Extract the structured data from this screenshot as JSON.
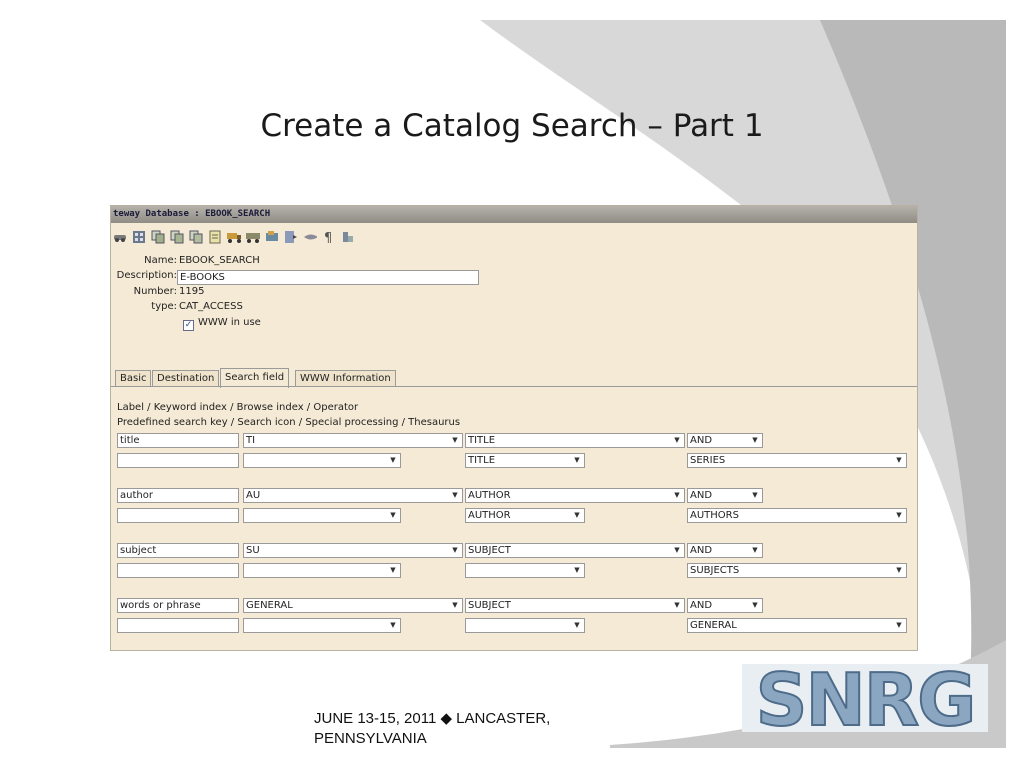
{
  "slide": {
    "title": "Create a Catalog Search – Part 1",
    "footer_line1": "JUNE 13-15, 2011 ◆ LANCASTER,",
    "footer_line2": "PENNSYLVANIA",
    "logo_text": "SNRG"
  },
  "window": {
    "title": "teway Database : EBOOK_SEARCH"
  },
  "toolbar": {
    "icons": [
      "car-icon",
      "grid-icon",
      "copy-icon",
      "copy-alt-icon",
      "copy-third-icon",
      "document-icon",
      "truck-icon",
      "vehicle-icon",
      "cart-icon",
      "export-icon",
      "handshake-icon",
      "paragraph-icon",
      "stack-icon"
    ]
  },
  "record": {
    "name_label": "Name:",
    "name_value": "EBOOK_SEARCH",
    "description_label": "Description:",
    "description_value": "E-BOOKS",
    "number_label": "Number:",
    "number_value": "1195",
    "type_label": "type:",
    "type_value": "CAT_ACCESS",
    "www_label": "WWW in use",
    "www_checked": true
  },
  "tabs": [
    {
      "label": "Basic"
    },
    {
      "label": "Destination"
    },
    {
      "label": "Search field"
    },
    {
      "label": "WWW Information"
    }
  ],
  "search_fields": {
    "header_line1": "Label / Keyword index / Browse index / Operator",
    "header_line2": "Predefined search key / Search icon / Special processing / Thesaurus",
    "rows": [
      {
        "label": "title",
        "keyword": "TI",
        "browse": "TITLE",
        "operator": "AND",
        "predef": "",
        "icon": "",
        "special": "TITLE",
        "thesaurus": "SERIES"
      },
      {
        "label": "author",
        "keyword": "AU",
        "browse": "AUTHOR",
        "operator": "AND",
        "predef": "",
        "icon": "",
        "special": "AUTHOR",
        "thesaurus": "AUTHORS"
      },
      {
        "label": "subject",
        "keyword": "SU",
        "browse": "SUBJECT",
        "operator": "AND",
        "predef": "",
        "icon": "",
        "special": "",
        "thesaurus": "SUBJECTS"
      },
      {
        "label": "words or phrase",
        "keyword": "GENERAL",
        "browse": "SUBJECT",
        "operator": "AND",
        "predef": "",
        "icon": "",
        "special": "",
        "thesaurus": "GENERAL"
      }
    ]
  },
  "colors": {
    "panel_bg": "#f5ead5",
    "swoosh_gray": "#bdbdbd",
    "swoosh_light": "#e4e4e4",
    "logo_blue": "#7f9fbd"
  }
}
